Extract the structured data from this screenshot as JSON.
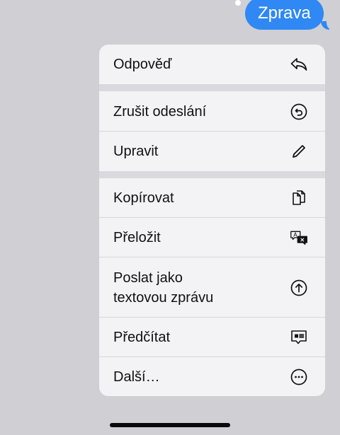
{
  "message": {
    "text": "Zprava",
    "bubble_color": "#2f88f3"
  },
  "menu": {
    "items": [
      {
        "label": "Odpověď",
        "icon": "reply-icon"
      },
      {
        "label": "Zrušit odeslání",
        "icon": "undo-send-icon"
      },
      {
        "label": "Upravit",
        "icon": "pencil-icon"
      },
      {
        "label": "Kopírovat",
        "icon": "copy-icon"
      },
      {
        "label": "Přeložit",
        "icon": "translate-icon"
      },
      {
        "label": "Poslat jako\ntextovou zprávu",
        "icon": "arrow-up-circle-icon"
      },
      {
        "label": "Předčítat",
        "icon": "speak-icon"
      },
      {
        "label": "Další…",
        "icon": "more-icon"
      }
    ]
  },
  "colors": {
    "background": "#cfcfd4",
    "menu_background": "#f3f3f5"
  }
}
